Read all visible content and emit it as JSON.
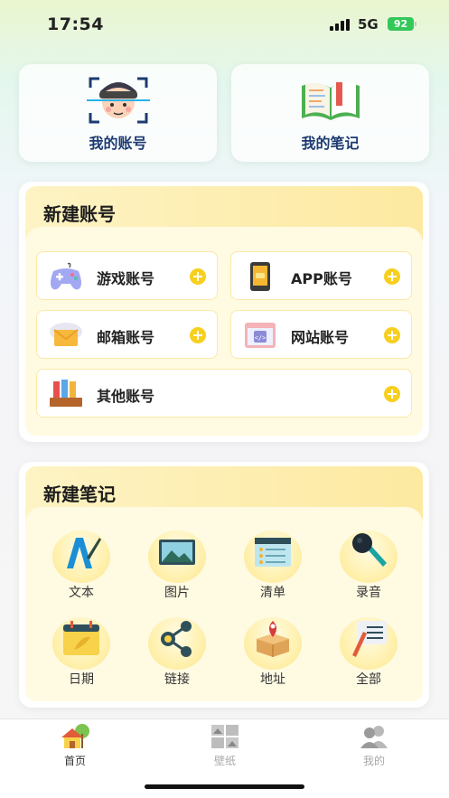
{
  "status_bar": {
    "time": "17:54",
    "network": "5G",
    "battery": "92"
  },
  "top_cards": [
    {
      "label": "我的账号",
      "icon": "face-scan-icon"
    },
    {
      "label": "我的笔记",
      "icon": "open-book-icon"
    }
  ],
  "new_account": {
    "title": "新建账号",
    "items": [
      {
        "label": "游戏账号",
        "icon": "gamepad-icon"
      },
      {
        "label": "APP账号",
        "icon": "phone-app-icon"
      },
      {
        "label": "邮箱账号",
        "icon": "mail-icon"
      },
      {
        "label": "网站账号",
        "icon": "browser-code-icon"
      },
      {
        "label": "其他账号",
        "icon": "folders-icon"
      }
    ]
  },
  "new_note": {
    "title": "新建笔记",
    "items": [
      {
        "label": "文本",
        "icon": "text-pen-icon"
      },
      {
        "label": "图片",
        "icon": "picture-icon"
      },
      {
        "label": "清单",
        "icon": "checklist-icon"
      },
      {
        "label": "录音",
        "icon": "microphone-icon"
      },
      {
        "label": "日期",
        "icon": "calendar-icon"
      },
      {
        "label": "链接",
        "icon": "share-link-icon"
      },
      {
        "label": "地址",
        "icon": "map-pin-box-icon"
      },
      {
        "label": "全部",
        "icon": "notes-all-icon"
      }
    ]
  },
  "tabbar": {
    "tabs": [
      {
        "label": "首页",
        "icon": "home-icon",
        "active": true
      },
      {
        "label": "壁纸",
        "icon": "wallpaper-icon",
        "active": false
      },
      {
        "label": "我的",
        "icon": "profile-icon",
        "active": false
      }
    ]
  },
  "colors": {
    "accent": "#f7cf1e",
    "title_blue": "#1d3b72",
    "section_bg": "#fffae2"
  }
}
